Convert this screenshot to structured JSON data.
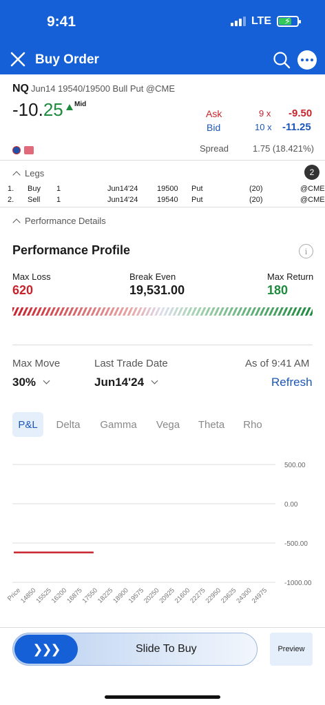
{
  "status": {
    "time": "9:41",
    "network": "LTE"
  },
  "nav": {
    "title": "Buy Order",
    "close_icon": "close-icon",
    "search_icon": "search-icon",
    "more_icon": "more-icon"
  },
  "quote": {
    "symbol": "NQ",
    "description": "Jun14 19540/19500 Bull Put @CME",
    "price_prefix": "-10.",
    "price_suffix": "25",
    "mid_label": "Mid",
    "ask_label": "Ask",
    "ask_size": "9 x",
    "ask_price": "-9.50",
    "bid_label": "Bid",
    "bid_size": "10 x",
    "bid_price": "-11.25",
    "spread_label": "Spread",
    "spread_value": "1.75 (18.421%)"
  },
  "legs": {
    "label": "Legs",
    "count": "2",
    "rows": [
      {
        "num": "1.",
        "side": "Buy",
        "qty": "1",
        "exp": "Jun14'24",
        "strike": "19500",
        "type": "Put",
        "mult": "(20)",
        "exch": "@CME"
      },
      {
        "num": "2.",
        "side": "Sell",
        "qty": "1",
        "exp": "Jun14'24",
        "strike": "19540",
        "type": "Put",
        "mult": "(20)",
        "exch": "@CME"
      }
    ]
  },
  "performance": {
    "toggle_label": "Performance Details",
    "title": "Performance Profile",
    "max_loss_label": "Max Loss",
    "max_loss": "620",
    "break_even_label": "Break Even",
    "break_even": "19,531.00",
    "max_return_label": "Max Return",
    "max_return": "180"
  },
  "controls": {
    "max_move_label": "Max Move",
    "max_move": "30%",
    "last_trade_label": "Last Trade Date",
    "last_trade": "Jun14'24",
    "as_of": "As of 9:41 AM",
    "refresh": "Refresh"
  },
  "tabs": [
    "P&L",
    "Delta",
    "Gamma",
    "Vega",
    "Theta",
    "Rho"
  ],
  "chart_data": {
    "type": "line",
    "x_ticks": [
      "Price",
      "14850",
      "15525",
      "16200",
      "16875",
      "17550",
      "18225",
      "18900",
      "19575",
      "20250",
      "20925",
      "21600",
      "22275",
      "22950",
      "23625",
      "24300",
      "24975"
    ],
    "y_ticks": [
      "500.00",
      "0.00",
      "-500.00",
      "-1000.00"
    ],
    "ylim": [
      -1000,
      500
    ],
    "series": [
      {
        "x": [
          14850,
          17550
        ],
        "values": [
          -620,
          -620
        ],
        "color": "#c8232c"
      }
    ]
  },
  "footer": {
    "slide_label": "Slide To Buy",
    "preview_label": "Preview"
  }
}
